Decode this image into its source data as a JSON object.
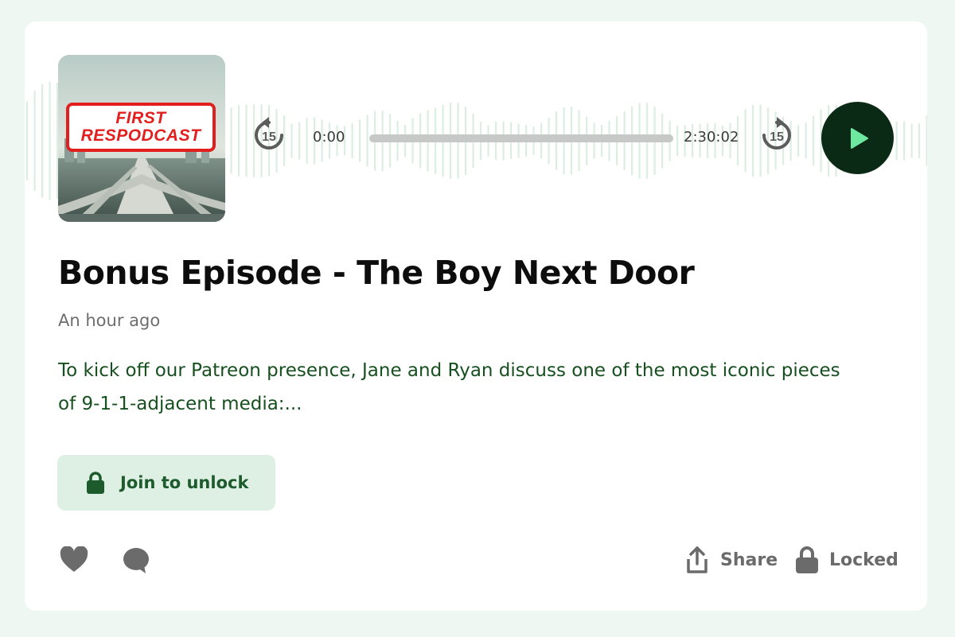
{
  "episode": {
    "cover_title_line1": "FIRST",
    "cover_title_line2": "RESPODCAST",
    "title": "Bonus Episode - The Boy Next Door",
    "posted": "An hour ago",
    "description": "To kick off our Patreon presence, Jane and Ryan discuss one of the most iconic pieces of 9-1-1-adjacent media:..."
  },
  "player": {
    "current_time": "0:00",
    "duration": "2:30:02",
    "progress": 0,
    "skip_back_seconds": "15",
    "skip_forward_seconds": "15",
    "play_icon": "play-icon"
  },
  "actions": {
    "join_label": "Join to unlock",
    "share_label": "Share",
    "locked_label": "Locked",
    "like_icon": "heart-icon",
    "comment_icon": "comment-icon"
  },
  "colors": {
    "page_background": "#eef7f1",
    "accent_dark": "#0b2a15",
    "play_icon": "#6ee7a0",
    "join_background": "#deefe4",
    "join_text": "#1d5a2c",
    "description_text": "#17501f",
    "waveform": "#dbeee1"
  }
}
